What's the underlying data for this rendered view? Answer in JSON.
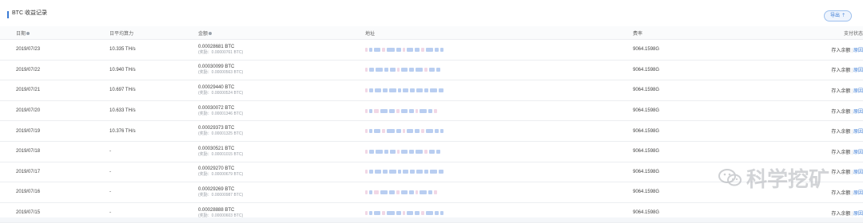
{
  "header": {
    "title": "BTC 收益记录",
    "export_label": "导出",
    "export_icon": "upload-icon"
  },
  "columns": {
    "date": "日期",
    "hashrate": "日平均算力",
    "amount": "金额",
    "address": "地址",
    "fee": "费率",
    "status": "支付状态"
  },
  "rows": [
    {
      "date": "2019/07/23",
      "hashrate": "10.335 TH/s",
      "amount": "0.00028681 BTC",
      "sub": "(奖励：0.00000761 BTC)",
      "fee": "9064.1598G",
      "status": "存入余额",
      "reason": "原因"
    },
    {
      "date": "2019/07/22",
      "hashrate": "10.940 TH/s",
      "amount": "0.00030099 BTC",
      "sub": "(奖励：0.00000563 BTC)",
      "fee": "9064.1598G",
      "status": "存入余额",
      "reason": "原因"
    },
    {
      "date": "2019/07/21",
      "hashrate": "10.697 TH/s",
      "amount": "0.00029440 BTC",
      "sub": "(奖励：0.00000524 BTC)",
      "fee": "9064.1598G",
      "status": "存入余额",
      "reason": "原因"
    },
    {
      "date": "2019/07/20",
      "hashrate": "10.633 TH/s",
      "amount": "0.00030072 BTC",
      "sub": "(奖励：0.00001346 BTC)",
      "fee": "9064.1598G",
      "status": "存入余额",
      "reason": "原因"
    },
    {
      "date": "2019/07/19",
      "hashrate": "10.376 TH/s",
      "amount": "0.00029373 BTC",
      "sub": "(奖励：0.00001325 BTC)",
      "fee": "9064.1598G",
      "status": "存入余额",
      "reason": "原因"
    },
    {
      "date": "2019/07/18",
      "hashrate": "-",
      "amount": "0.00030521 BTC",
      "sub": "(奖励：0.00001015 BTC)",
      "fee": "9064.1598G",
      "status": "存入余额",
      "reason": "原因"
    },
    {
      "date": "2019/07/17",
      "hashrate": "-",
      "amount": "0.00029270 BTC",
      "sub": "(奖励：0.00000679 BTC)",
      "fee": "9064.1598G",
      "status": "存入余额",
      "reason": "原因"
    },
    {
      "date": "2019/07/16",
      "hashrate": "-",
      "amount": "0.00029269 BTC",
      "sub": "(奖励：0.00000987 BTC)",
      "fee": "9064.1598G",
      "status": "存入余额",
      "reason": "原因"
    },
    {
      "date": "2019/07/15",
      "hashrate": "-",
      "amount": "0.00028888 BTC",
      "sub": "(奖励：0.00000603 BTC)",
      "fee": "9064.1598G",
      "status": "存入余额",
      "reason": "原因"
    }
  ],
  "watermark": {
    "text": "科学挖矿",
    "icon": "wechat-icon"
  },
  "colors": {
    "accent": "#3a7bd5",
    "blur_blue": "#7fa6e6",
    "blur_pink": "#e6b6cf"
  }
}
